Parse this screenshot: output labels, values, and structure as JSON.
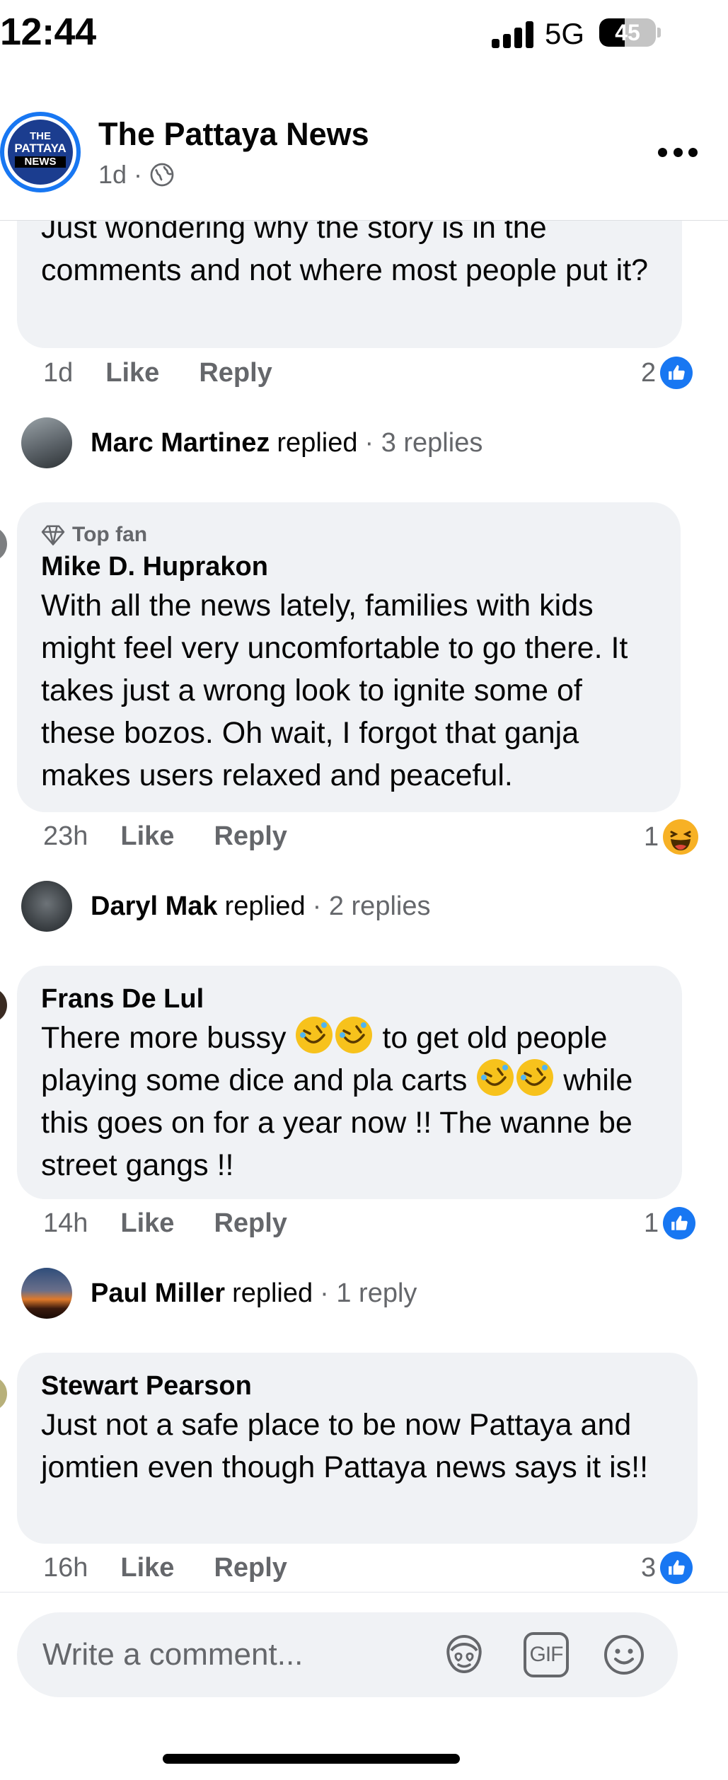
{
  "status_bar": {
    "time": "12:44",
    "network": "5G",
    "battery": "45",
    "battery_level": 0.45
  },
  "post": {
    "page_name": "The Pattaya News",
    "avatar_text": [
      "THE",
      "PATTAYA",
      "NEWS"
    ],
    "age": "1d",
    "separator": "·",
    "audience_icon": "globe-icon",
    "more_icon": "more-options-icon"
  },
  "comments": [
    {
      "author": "",
      "text": "Just wondering why the story is in the comments and not where most people put it?",
      "time": "1d",
      "like": "Like",
      "reply": "Reply",
      "reaction_count": "2",
      "reaction": "like-icon",
      "replies": {
        "name": "Marc Martinez",
        "word": "replied",
        "count": "· 3 replies"
      }
    },
    {
      "badge": "Top fan",
      "author": "Mike D. Huprakon",
      "text": "With all the news lately, families with kids might feel very uncomfortable to go there. It takes just a wrong look to ignite some of these bozos. Oh wait, I forgot that ganja makes users relaxed and peaceful.",
      "time": "23h",
      "like": "Like",
      "reply": "Reply",
      "reaction_count": "1",
      "reaction": "haha-icon",
      "replies": {
        "name": "Daryl Mak",
        "word": "replied",
        "count": "· 2 replies"
      }
    },
    {
      "author": "Frans De Lul",
      "text_parts": [
        "There more bussy",
        "to get old people playing some dice and pla carts",
        "while this goes on for a year now !! The wanne be street gangs !!"
      ],
      "time": "14h",
      "like": "Like",
      "reply": "Reply",
      "reaction_count": "1",
      "reaction": "like-icon",
      "replies": {
        "name": "Paul Miller",
        "word": "replied",
        "count": "· 1 reply"
      }
    },
    {
      "author": "Stewart Pearson",
      "text": "Just not a safe place to be now Pattaya and jomtien even though Pattaya news says it is!!",
      "time": "16h",
      "like": "Like",
      "reply": "Reply",
      "reaction_count": "3",
      "reaction": "like-icon"
    }
  ],
  "composer": {
    "placeholder": "Write a comment...",
    "gif_label": "GIF",
    "icons": [
      "avatar-sticker-icon",
      "gif-icon",
      "emoji-icon"
    ]
  },
  "colors": {
    "accent": "#1877f2",
    "bubble": "#f0f2f5",
    "secondary_text": "#65676b",
    "haha": "#f7b125"
  }
}
